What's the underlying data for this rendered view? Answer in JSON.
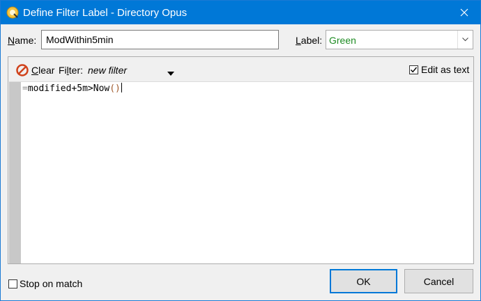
{
  "window": {
    "title": "Define Filter Label - Directory Opus"
  },
  "name_field": {
    "label": "Name:",
    "value": "ModWithin5min"
  },
  "label_field": {
    "label": "Label:",
    "value": "Green",
    "value_color": "#1e8c23"
  },
  "toolbar": {
    "clear_label": "Clear",
    "filter_label": "Filter:",
    "filter_value": "new filter",
    "edit_as_text_label": "Edit as text",
    "edit_as_text_checked": true
  },
  "editor": {
    "code_op": "=",
    "code_main": "modified+5m>Now",
    "code_paren": "()"
  },
  "footer": {
    "stop_on_match_label": "Stop on match",
    "stop_on_match_checked": false,
    "ok_label": "OK",
    "cancel_label": "Cancel"
  },
  "colors": {
    "titlebar": "#0078d7",
    "accent": "#0078d7"
  }
}
